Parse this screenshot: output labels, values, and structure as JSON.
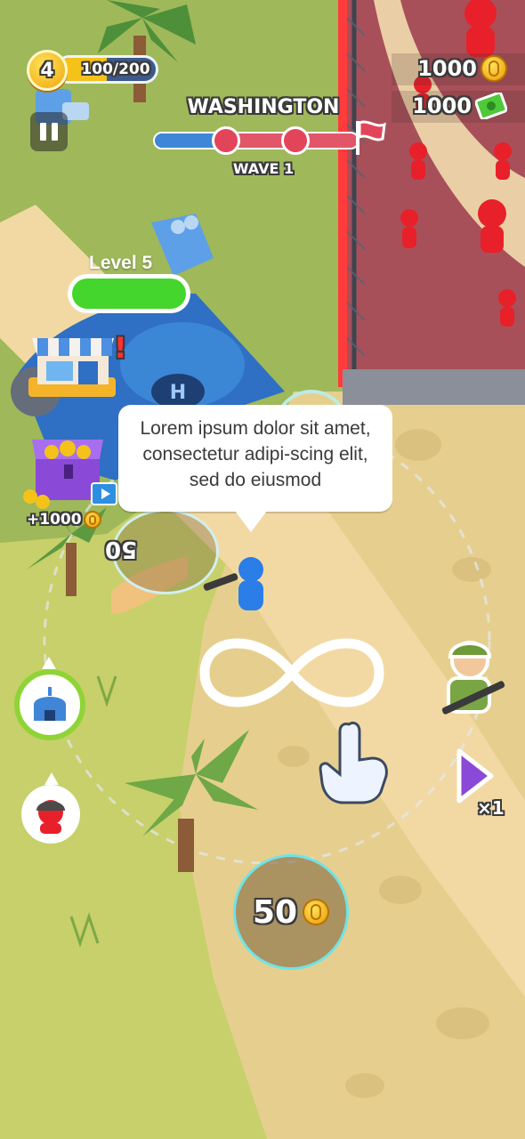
{
  "player": {
    "level": "4",
    "xp": "100/200",
    "xp_fraction": 0.5
  },
  "hud": {
    "city": "WASHINGTON",
    "wave": "WAVE 1",
    "wave_progress": 0.3,
    "coins": "1000",
    "cash": "1000"
  },
  "tooltip": {
    "text": "Lorem ipsum dolor sit amet, consectetur adipi-scing elit, sed do eiusmod"
  },
  "tower": {
    "label": "Level 5"
  },
  "chest": {
    "reward": "+1000"
  },
  "costs": {
    "main": "50",
    "side": "50"
  },
  "speed": {
    "multiplier": "×1"
  },
  "icons": {
    "pause": "pause-icon",
    "coin": "coin-icon",
    "cash": "cash-icon",
    "flag": "flag-icon",
    "shop": "shop-icon",
    "chest": "chest-icon",
    "video": "video-icon",
    "base": "base-icon",
    "enemy": "enemy-icon",
    "soldier": "soldier-icon",
    "play": "play-icon",
    "hand": "hand-pointer-icon",
    "infinity": "infinity-gesture-icon"
  },
  "colors": {
    "grass": "#9fb85a",
    "sand": "#e6cf8e",
    "path": "#f2d9a4",
    "enemy_zone": "#a8505a",
    "accent_blue": "#3f86d8",
    "accent_red": "#e2455a",
    "gold": "#f5c21a"
  }
}
